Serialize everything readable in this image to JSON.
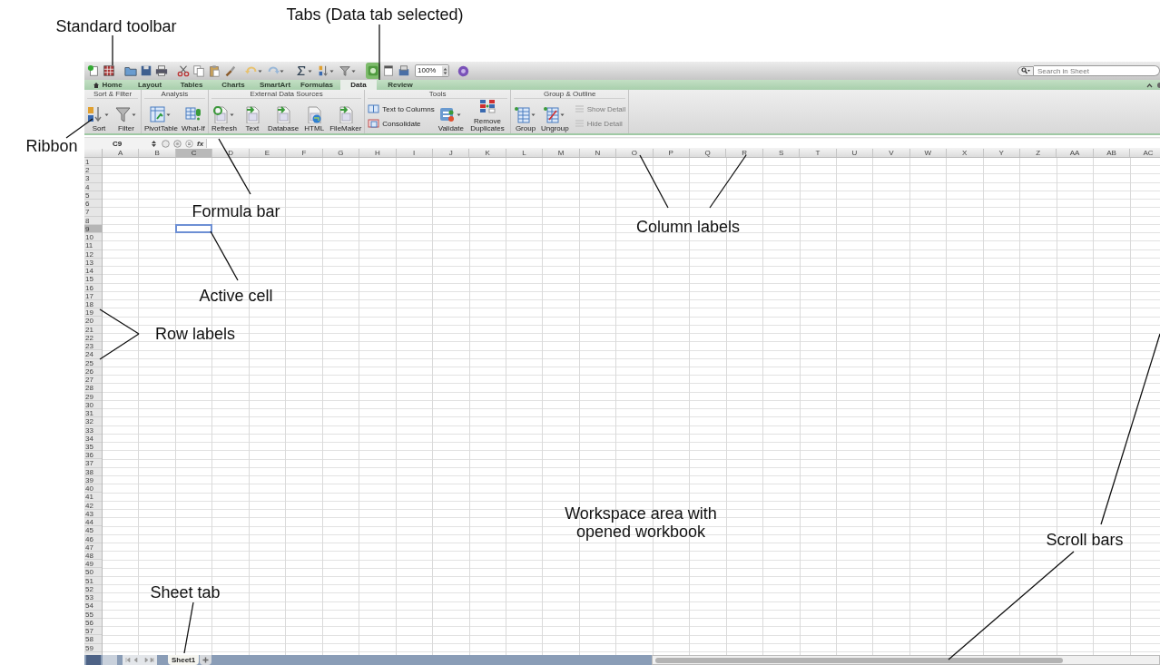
{
  "toolbar": {
    "gallery_button": {
      "on": true
    },
    "zoom": "100%",
    "search_placeholder": "Search in Sheet"
  },
  "tabs": [
    {
      "label": "Home",
      "kind": "home",
      "selected": false
    },
    {
      "label": "Layout",
      "kind": "plain",
      "selected": false
    },
    {
      "label": "Tables",
      "kind": "plain",
      "selected": false
    },
    {
      "label": "Charts",
      "kind": "plain",
      "selected": false
    },
    {
      "label": "SmartArt",
      "kind": "plain",
      "selected": false
    },
    {
      "label": "Formulas",
      "kind": "plain",
      "selected": false
    },
    {
      "label": "Data",
      "kind": "plain",
      "selected": true
    },
    {
      "label": "Review",
      "kind": "plain",
      "selected": false
    }
  ],
  "ribbon": {
    "groups": [
      {
        "title": "Sort & Filter",
        "buttons": [
          {
            "label": "Sort",
            "kind": "large",
            "dropdown": true,
            "disabled": false
          },
          {
            "label": "Filter",
            "kind": "large",
            "dropdown": true,
            "disabled": false
          }
        ]
      },
      {
        "title": "Analysis",
        "buttons": [
          {
            "label": "PivotTable",
            "kind": "large",
            "dropdown": true,
            "disabled": false
          },
          {
            "label": "What-If",
            "kind": "large",
            "dropdown": false,
            "disabled": false
          }
        ]
      },
      {
        "title": "External Data Sources",
        "buttons": [
          {
            "label": "Refresh",
            "kind": "large",
            "dropdown": true,
            "disabled": false
          },
          {
            "label": "Text",
            "kind": "large",
            "dropdown": false,
            "disabled": false
          },
          {
            "label": "Database",
            "kind": "large",
            "dropdown": false,
            "disabled": false
          },
          {
            "label": "HTML",
            "kind": "large",
            "dropdown": false,
            "disabled": false
          },
          {
            "label": "FileMaker",
            "kind": "large",
            "dropdown": false,
            "disabled": false
          }
        ]
      },
      {
        "title": "Tools",
        "buttons": [
          {
            "label": "Text to Columns",
            "kind": "small",
            "disabled": false
          },
          {
            "label": "Consolidate",
            "kind": "small",
            "disabled": false
          },
          {
            "label": "Validate",
            "kind": "large",
            "dropdown": true,
            "disabled": false
          },
          {
            "label": "Remove Duplicates",
            "kind": "large",
            "dropdown": false,
            "disabled": false
          }
        ]
      },
      {
        "title": "Group & Outline",
        "buttons": [
          {
            "label": "Group",
            "kind": "large",
            "dropdown": true,
            "disabled": false
          },
          {
            "label": "Ungroup",
            "kind": "large",
            "dropdown": true,
            "disabled": false
          },
          {
            "label": "Show Detail",
            "kind": "small",
            "disabled": true
          },
          {
            "label": "Hide Detail",
            "kind": "small",
            "disabled": true
          }
        ]
      }
    ]
  },
  "formula_bar": {
    "name_box": "C9",
    "function_label": "fx"
  },
  "columns": [
    {
      "label": "A",
      "selected": false
    },
    {
      "label": "B",
      "selected": false
    },
    {
      "label": "C",
      "selected": true
    },
    {
      "label": "D",
      "selected": false
    },
    {
      "label": "E",
      "selected": false
    },
    {
      "label": "F",
      "selected": false
    },
    {
      "label": "G",
      "selected": false
    },
    {
      "label": "H",
      "selected": false
    },
    {
      "label": "I",
      "selected": false
    },
    {
      "label": "J",
      "selected": false
    },
    {
      "label": "K",
      "selected": false
    },
    {
      "label": "L",
      "selected": false
    },
    {
      "label": "M",
      "selected": false
    },
    {
      "label": "N",
      "selected": false
    },
    {
      "label": "O",
      "selected": false
    },
    {
      "label": "P",
      "selected": false
    },
    {
      "label": "Q",
      "selected": false
    },
    {
      "label": "R",
      "selected": false
    },
    {
      "label": "S",
      "selected": false
    },
    {
      "label": "T",
      "selected": false
    },
    {
      "label": "U",
      "selected": false
    },
    {
      "label": "V",
      "selected": false
    },
    {
      "label": "W",
      "selected": false
    },
    {
      "label": "X",
      "selected": false
    },
    {
      "label": "Y",
      "selected": false
    },
    {
      "label": "Z",
      "selected": false
    },
    {
      "label": "AA",
      "selected": false
    },
    {
      "label": "AB",
      "selected": false
    },
    {
      "label": "AC",
      "selected": false
    }
  ],
  "rows": [
    {
      "label": "1",
      "selected": false
    },
    {
      "label": "2",
      "selected": false
    },
    {
      "label": "3",
      "selected": false
    },
    {
      "label": "4",
      "selected": false
    },
    {
      "label": "5",
      "selected": false
    },
    {
      "label": "6",
      "selected": false
    },
    {
      "label": "7",
      "selected": false
    },
    {
      "label": "8",
      "selected": false
    },
    {
      "label": "9",
      "selected": true
    },
    {
      "label": "10",
      "selected": false
    },
    {
      "label": "11",
      "selected": false
    },
    {
      "label": "12",
      "selected": false
    },
    {
      "label": "13",
      "selected": false
    },
    {
      "label": "14",
      "selected": false
    },
    {
      "label": "15",
      "selected": false
    },
    {
      "label": "16",
      "selected": false
    },
    {
      "label": "17",
      "selected": false
    },
    {
      "label": "18",
      "selected": false
    },
    {
      "label": "19",
      "selected": false
    },
    {
      "label": "20",
      "selected": false
    },
    {
      "label": "21",
      "selected": false
    },
    {
      "label": "22",
      "selected": false
    },
    {
      "label": "23",
      "selected": false
    },
    {
      "label": "24",
      "selected": false
    },
    {
      "label": "25",
      "selected": false
    },
    {
      "label": "26",
      "selected": false
    },
    {
      "label": "27",
      "selected": false
    },
    {
      "label": "28",
      "selected": false
    },
    {
      "label": "29",
      "selected": false
    },
    {
      "label": "30",
      "selected": false
    },
    {
      "label": "31",
      "selected": false
    },
    {
      "label": "32",
      "selected": false
    },
    {
      "label": "33",
      "selected": false
    },
    {
      "label": "34",
      "selected": false
    },
    {
      "label": "35",
      "selected": false
    },
    {
      "label": "36",
      "selected": false
    },
    {
      "label": "37",
      "selected": false
    },
    {
      "label": "38",
      "selected": false
    },
    {
      "label": "39",
      "selected": false
    },
    {
      "label": "40",
      "selected": false
    },
    {
      "label": "41",
      "selected": false
    },
    {
      "label": "42",
      "selected": false
    },
    {
      "label": "43",
      "selected": false
    },
    {
      "label": "44",
      "selected": false
    },
    {
      "label": "45",
      "selected": false
    },
    {
      "label": "46",
      "selected": false
    },
    {
      "label": "47",
      "selected": false
    },
    {
      "label": "48",
      "selected": false
    },
    {
      "label": "49",
      "selected": false
    },
    {
      "label": "50",
      "selected": false
    },
    {
      "label": "51",
      "selected": false
    },
    {
      "label": "52",
      "selected": false
    },
    {
      "label": "53",
      "selected": false
    },
    {
      "label": "54",
      "selected": false
    },
    {
      "label": "55",
      "selected": false
    },
    {
      "label": "56",
      "selected": false
    },
    {
      "label": "57",
      "selected": false
    },
    {
      "label": "58",
      "selected": false
    },
    {
      "label": "59",
      "selected": false
    }
  ],
  "view_buttons": [
    {
      "selected": true
    },
    {
      "selected": false
    }
  ],
  "sheet_tabs": [
    {
      "label": "Sheet1",
      "selected": true
    }
  ],
  "annotations": [
    {
      "text": "Standard toolbar"
    },
    {
      "text": "Tabs (Data tab selected)"
    },
    {
      "text": "Ribbon"
    },
    {
      "text": "Formula bar"
    },
    {
      "text": "Column labels"
    },
    {
      "text": "Active cell"
    },
    {
      "text": "Row labels"
    },
    {
      "text": "Workspace area with opened workbook"
    },
    {
      "text": "Scroll bars"
    },
    {
      "text": "Sheet tab"
    }
  ]
}
